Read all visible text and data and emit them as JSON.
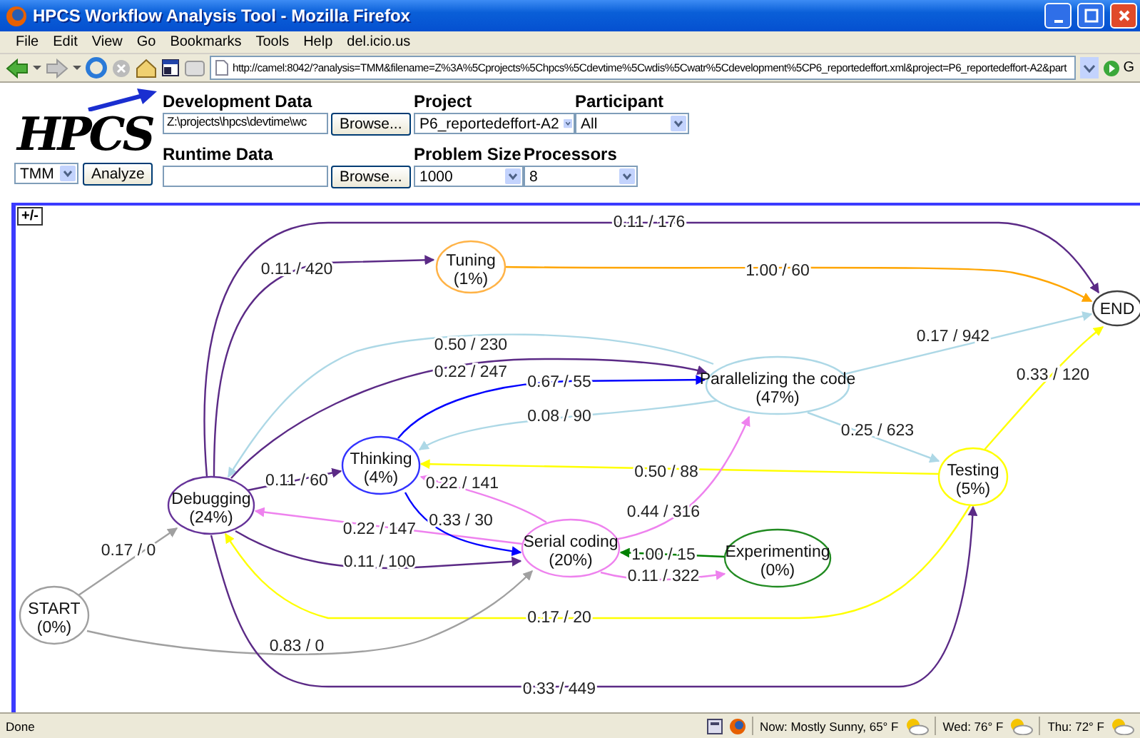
{
  "window": {
    "title": "HPCS Workflow Analysis Tool - Mozilla Firefox"
  },
  "menu": [
    "File",
    "Edit",
    "View",
    "Go",
    "Bookmarks",
    "Tools",
    "Help",
    "del.icio.us"
  ],
  "address": {
    "value": "http://camel:8042/?analysis=TMM&filename=Z%3A%5Cprojects%5Chpcs%5Cdevtime%5Cwdis%5Cwatr%5Cdevelopment%5CP6_reportedeffort.xml&project=P6_reportedeffort-A2&part"
  },
  "go_button": "G",
  "logo": "HPCS",
  "form": {
    "analysis": {
      "value": "TMM"
    },
    "analyze_button": "Analyze",
    "development_data": {
      "label": "Development Data",
      "value": "Z:\\projects\\hpcs\\devtime\\wc",
      "button": "Browse..."
    },
    "runtime_data": {
      "label": "Runtime Data",
      "button": "Browse..."
    },
    "project": {
      "label": "Project",
      "value": "P6_reportedeffort-A2"
    },
    "participant": {
      "label": "Participant",
      "value": "All"
    },
    "problem_size": {
      "label": "Problem Size",
      "value": "1000"
    },
    "processors": {
      "label": "Processors",
      "value": "8"
    }
  },
  "graph": {
    "toggle": "+/-",
    "nodes": [
      {
        "name": "Tuning",
        "share": "(1%)",
        "color": "#ffb347"
      },
      {
        "name": "END",
        "color": "#404040"
      },
      {
        "name": "Parallelizing the code",
        "share": "(47%)",
        "color": "#add8e6"
      },
      {
        "name": "Thinking",
        "share": "(4%)",
        "color": "#3333ff"
      },
      {
        "name": "Debugging",
        "share": "(24%)",
        "color": "#663399"
      },
      {
        "name": "Testing",
        "share": "(5%)",
        "color": "#ffff00"
      },
      {
        "name": "Serial coding",
        "share": "(20%)",
        "color": "#ee82ee"
      },
      {
        "name": "Experimenting",
        "share": "(0%)",
        "color": "#228b22"
      },
      {
        "name": "START",
        "share": "(0%)",
        "color": "#a0a0a0"
      }
    ],
    "edges": [
      {
        "label": "0.11 / 176",
        "color": "#5b2a86"
      },
      {
        "label": "0.11 / 420",
        "color": "#5b2a86"
      },
      {
        "label": "1.00 / 60",
        "color": "#ffa500"
      },
      {
        "label": "0.50 / 230",
        "color": "#add8e6"
      },
      {
        "label": "0.22 / 247",
        "color": "#5b2a86"
      },
      {
        "label": "0.67 / 55",
        "color": "#0000ff"
      },
      {
        "label": "0.08 / 90",
        "color": "#add8e6"
      },
      {
        "label": "0.17 / 942",
        "color": "#add8e6"
      },
      {
        "label": "0.33 / 120",
        "color": "#ffff00"
      },
      {
        "label": "0.25 / 623",
        "color": "#add8e6"
      },
      {
        "label": "0.11 / 60",
        "color": "#5b2a86"
      },
      {
        "label": "0.50 / 88",
        "color": "#ffff00"
      },
      {
        "label": "0.22 / 141",
        "color": "#ee82ee"
      },
      {
        "label": "0.44 / 316",
        "color": "#ee82ee"
      },
      {
        "label": "0.22 / 147",
        "color": "#ee82ee"
      },
      {
        "label": "0.33 / 30",
        "color": "#0000ff"
      },
      {
        "label": "0.11 / 100",
        "color": "#5b2a86"
      },
      {
        "label": "1.00 / 15",
        "color": "#008000"
      },
      {
        "label": "0.11 / 322",
        "color": "#ee82ee"
      },
      {
        "label": "0.17 / 0",
        "color": "#a0a0a0"
      },
      {
        "label": "0.17 / 20",
        "color": "#ffff00"
      },
      {
        "label": "0.83 / 0",
        "color": "#a0a0a0"
      },
      {
        "label": "0.33 / 449",
        "color": "#5b2a86"
      }
    ]
  },
  "status_bar": {
    "text": "Done",
    "weather": [
      "Now: Mostly Sunny, 65° F",
      "Wed: 76° F",
      "Thu: 72° F"
    ]
  }
}
